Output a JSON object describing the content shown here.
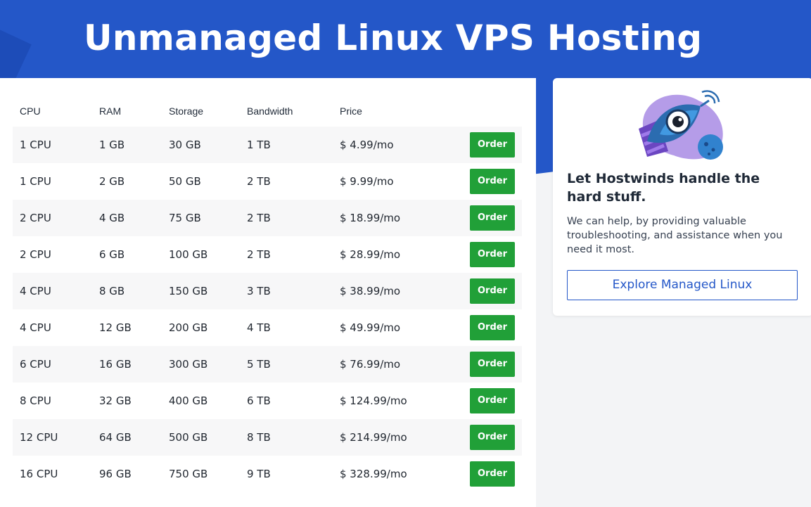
{
  "header": {
    "title": "Unmanaged Linux VPS Hosting"
  },
  "colors": {
    "brand_blue": "#2457c8",
    "order_green": "#21a038"
  },
  "pricing": {
    "columns": [
      "CPU",
      "RAM",
      "Storage",
      "Bandwidth",
      "Price"
    ],
    "order_label": "Order",
    "rows": [
      {
        "cpu": "1 CPU",
        "ram": "1 GB",
        "storage": "30 GB",
        "bandwidth": "1 TB",
        "price": "$ 4.99/mo"
      },
      {
        "cpu": "1 CPU",
        "ram": "2 GB",
        "storage": "50 GB",
        "bandwidth": "2 TB",
        "price": "$ 9.99/mo"
      },
      {
        "cpu": "2 CPU",
        "ram": "4 GB",
        "storage": "75 GB",
        "bandwidth": "2 TB",
        "price": "$ 18.99/mo"
      },
      {
        "cpu": "2 CPU",
        "ram": "6 GB",
        "storage": "100 GB",
        "bandwidth": "2 TB",
        "price": "$ 28.99/mo"
      },
      {
        "cpu": "4 CPU",
        "ram": "8 GB",
        "storage": "150 GB",
        "bandwidth": "3 TB",
        "price": "$ 38.99/mo"
      },
      {
        "cpu": "4 CPU",
        "ram": "12 GB",
        "storage": "200 GB",
        "bandwidth": "4 TB",
        "price": "$ 49.99/mo"
      },
      {
        "cpu": "6 CPU",
        "ram": "16 GB",
        "storage": "300 GB",
        "bandwidth": "5 TB",
        "price": "$ 76.99/mo"
      },
      {
        "cpu": "8 CPU",
        "ram": "32 GB",
        "storage": "400 GB",
        "bandwidth": "6 TB",
        "price": "$ 124.99/mo"
      },
      {
        "cpu": "12 CPU",
        "ram": "64 GB",
        "storage": "500 GB",
        "bandwidth": "8 TB",
        "price": "$ 214.99/mo"
      },
      {
        "cpu": "16 CPU",
        "ram": "96 GB",
        "storage": "750 GB",
        "bandwidth": "9 TB",
        "price": "$ 328.99/mo"
      }
    ]
  },
  "promo": {
    "icon": "rocket-mascot-icon",
    "heading": "Let Hostwinds handle the hard stuff.",
    "text": "We can help, by providing valuable troubleshooting, and assistance when you need it most.",
    "button_label": "Explore Managed Linux"
  }
}
